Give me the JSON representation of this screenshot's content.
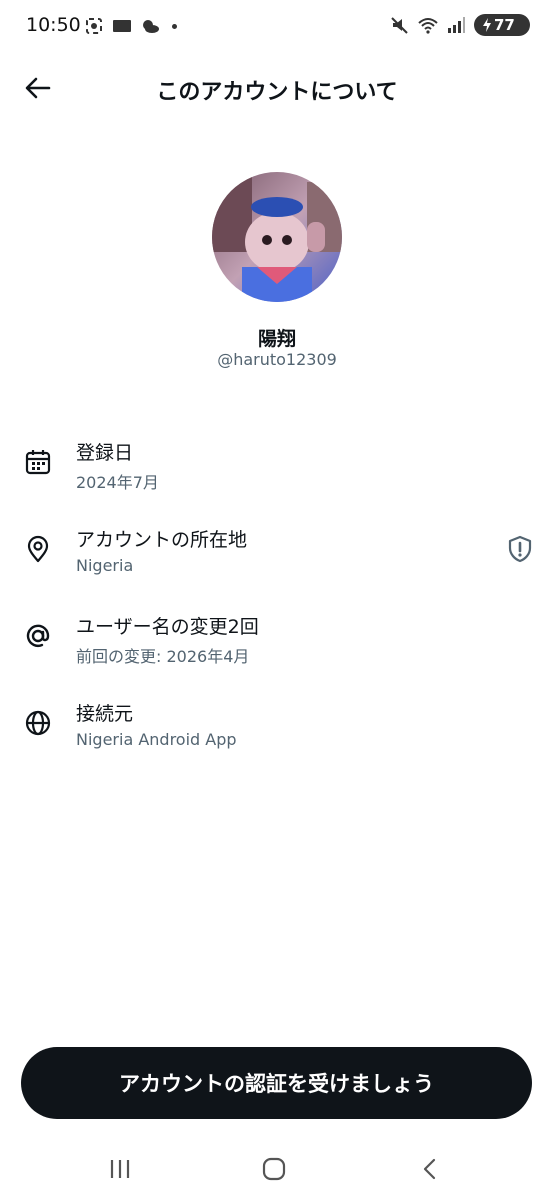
{
  "status_bar": {
    "time": "10:50",
    "battery": "77",
    "icons": [
      "screenshot-icon",
      "app-badge-icon",
      "weather-cloud-icon",
      "notification-dot",
      "mute-icon",
      "wifi-icon",
      "signal-icon",
      "battery-icon"
    ]
  },
  "header": {
    "title": "このアカウントについて",
    "back_icon": "arrow-left-icon"
  },
  "profile": {
    "display_name": "陽翔",
    "handle": "@haruto12309"
  },
  "info": [
    {
      "icon": "calendar-icon",
      "title": "登録日",
      "sub": "2024年7月"
    },
    {
      "icon": "location-pin-icon",
      "title": "アカウントの所在地",
      "sub": "Nigeria",
      "right_icon": "shield-exclamation-icon"
    },
    {
      "icon": "at-sign-icon",
      "title": "ユーザー名の変更2回",
      "sub": "前回の変更: 2026年4月"
    },
    {
      "icon": "globe-icon",
      "title": "接続元",
      "sub": "Nigeria Android App"
    }
  ],
  "cta": {
    "label": "アカウントの認証を受けましょう"
  },
  "nav": {
    "icons": [
      "recent-apps-icon",
      "home-icon",
      "back-icon"
    ]
  },
  "colors": {
    "primary_text": "#0f1419",
    "secondary_text": "#536471",
    "cta_bg": "#0f1419"
  }
}
